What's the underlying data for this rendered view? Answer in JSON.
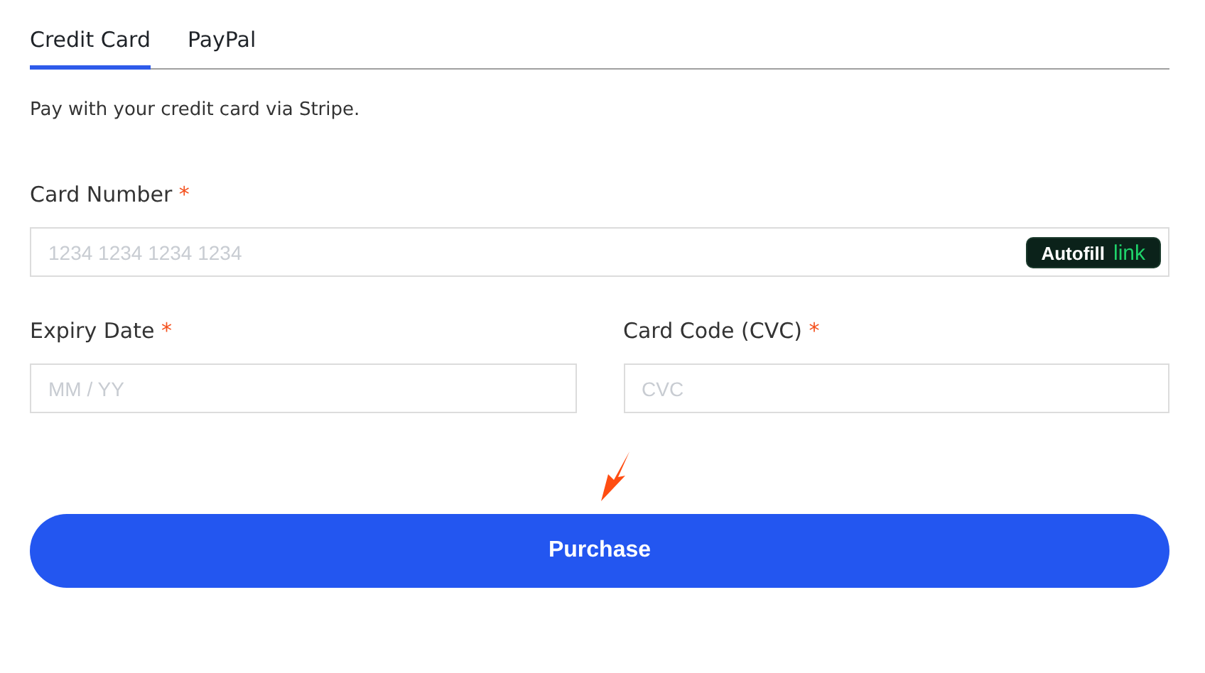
{
  "tabs": [
    {
      "label": "Credit Card",
      "selected": true
    },
    {
      "label": "PayPal",
      "selected": false
    }
  ],
  "description": "Pay with your credit card via Stripe.",
  "fields": [
    {
      "label": "Card Number",
      "required_mark": "*",
      "placeholder": "1234 1234 1234 1234",
      "autofill": {
        "label": "Autofill",
        "brand": "link"
      }
    },
    {
      "label": "Expiry Date",
      "required_mark": "*",
      "placeholder": "MM / YY"
    },
    {
      "label": "Card Code (CVC)",
      "required_mark": "*",
      "placeholder": "CVC"
    }
  ],
  "submit_button": "Purchase"
}
